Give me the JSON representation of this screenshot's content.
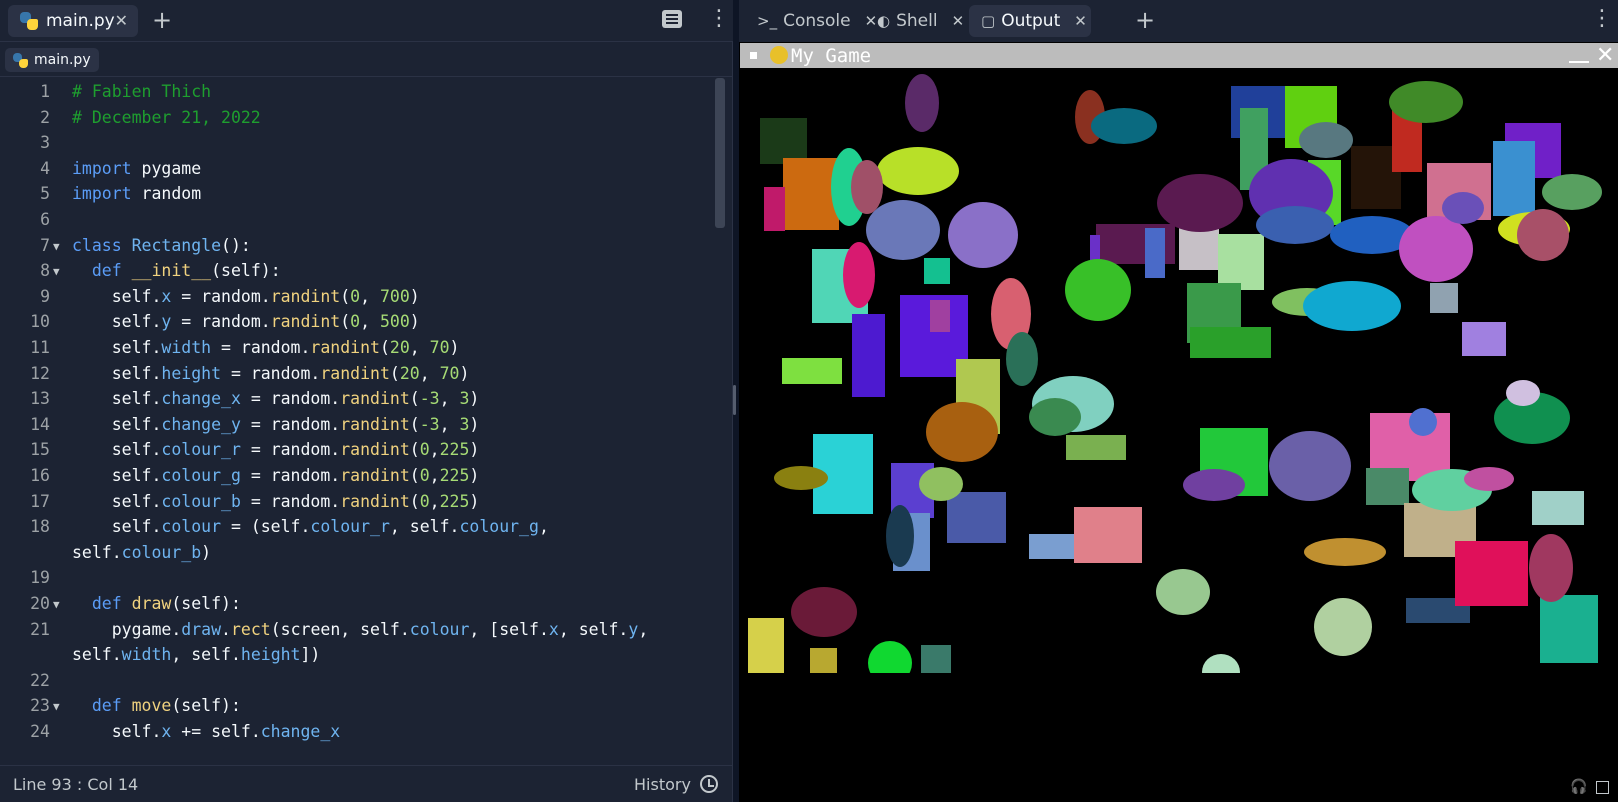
{
  "editor": {
    "tab_label": "main.py",
    "breadcrumb_label": "main.py",
    "status_position": "Line 93 : Col 14",
    "history_label": "History",
    "lines": [
      {
        "n": "1",
        "fold": false,
        "html": "<span class=\"cm\"># Fabien Thich</span>"
      },
      {
        "n": "2",
        "fold": false,
        "html": "<span class=\"cm\"># December 21, 2022</span>"
      },
      {
        "n": "3",
        "fold": false,
        "html": ""
      },
      {
        "n": "4",
        "fold": false,
        "html": "<span class=\"kw\">import</span> pygame"
      },
      {
        "n": "5",
        "fold": false,
        "html": "<span class=\"kw\">import</span> random"
      },
      {
        "n": "6",
        "fold": false,
        "html": ""
      },
      {
        "n": "7",
        "fold": true,
        "html": "<span class=\"kw\">class</span> <span class=\"at\">Rectangle</span>():"
      },
      {
        "n": "8",
        "fold": true,
        "html": "  <span class=\"kw\">def</span> <span class=\"fn\">__init__</span>(self):"
      },
      {
        "n": "9",
        "fold": false,
        "html": "    self.<span class=\"at\">x</span> = random.<span class=\"fn\">randint</span>(<span class=\"num\">0</span>, <span class=\"num\">700</span>)"
      },
      {
        "n": "10",
        "fold": false,
        "html": "    self.<span class=\"at\">y</span> = random.<span class=\"fn\">randint</span>(<span class=\"num\">0</span>, <span class=\"num\">500</span>)"
      },
      {
        "n": "11",
        "fold": false,
        "html": "    self.<span class=\"at\">width</span> = random.<span class=\"fn\">randint</span>(<span class=\"num\">20</span>, <span class=\"num\">70</span>)"
      },
      {
        "n": "12",
        "fold": false,
        "html": "    self.<span class=\"at\">height</span> = random.<span class=\"fn\">randint</span>(<span class=\"num\">20</span>, <span class=\"num\">70</span>)"
      },
      {
        "n": "13",
        "fold": false,
        "html": "    self.<span class=\"at\">change_x</span> = random.<span class=\"fn\">randint</span>(<span class=\"num\">-3</span>, <span class=\"num\">3</span>)"
      },
      {
        "n": "14",
        "fold": false,
        "html": "    self.<span class=\"at\">change_y</span> = random.<span class=\"fn\">randint</span>(<span class=\"num\">-3</span>, <span class=\"num\">3</span>)"
      },
      {
        "n": "15",
        "fold": false,
        "html": "    self.<span class=\"at\">colour_r</span> = random.<span class=\"fn\">randint</span>(<span class=\"num\">0</span>,<span class=\"num\">225</span>)"
      },
      {
        "n": "16",
        "fold": false,
        "html": "    self.<span class=\"at\">colour_g</span> = random.<span class=\"fn\">randint</span>(<span class=\"num\">0</span>,<span class=\"num\">225</span>)"
      },
      {
        "n": "17",
        "fold": false,
        "html": "    self.<span class=\"at\">colour_b</span> = random.<span class=\"fn\">randint</span>(<span class=\"num\">0</span>,<span class=\"num\">225</span>)"
      },
      {
        "n": "18",
        "fold": false,
        "html": "    self.<span class=\"at\">colour</span> = (self.<span class=\"at\">colour_r</span>, self.<span class=\"at\">colour_g</span>,"
      },
      {
        "n": "",
        "fold": false,
        "html": "self.<span class=\"at\">colour_b</span>)",
        "wrap": true
      },
      {
        "n": "19",
        "fold": false,
        "html": ""
      },
      {
        "n": "20",
        "fold": true,
        "html": "  <span class=\"kw\">def</span> <span class=\"fn\">draw</span>(self):"
      },
      {
        "n": "21",
        "fold": false,
        "html": "    pygame.<span class=\"at\">draw</span>.<span class=\"fn\">rect</span>(screen, self.<span class=\"at\">colour</span>, [self.<span class=\"at\">x</span>, self.<span class=\"at\">y</span>,"
      },
      {
        "n": "",
        "fold": false,
        "html": "self.<span class=\"at\">width</span>, self.<span class=\"at\">height</span>])",
        "wrap": true
      },
      {
        "n": "22",
        "fold": false,
        "html": ""
      },
      {
        "n": "23",
        "fold": true,
        "html": "  <span class=\"kw\">def</span> <span class=\"fn\">move</span>(self):"
      },
      {
        "n": "24",
        "fold": false,
        "html": "    self.<span class=\"at\">x</span> += self.<span class=\"at\">change_x</span>"
      }
    ]
  },
  "right_tabs": [
    {
      "label": "Console",
      "icon": "terminal-icon",
      "glyph": ">_",
      "active": false
    },
    {
      "label": "Shell",
      "icon": "shell-icon",
      "glyph": "◐",
      "active": false
    },
    {
      "label": "Output",
      "icon": "monitor-icon",
      "glyph": "▢",
      "active": true
    }
  ],
  "game": {
    "title": "My Game",
    "rects": [
      [
        "#1b3a18"
      ],
      [
        "#cc6a10"
      ],
      [
        "#c01a6a"
      ],
      [
        "#50d6b6"
      ],
      [
        "#4d1ad0"
      ],
      [
        "#5a1adb"
      ],
      [
        "#7ee040"
      ],
      [
        "#2ad2d6"
      ],
      [
        "#5b3fd0"
      ],
      [
        "#6a90cc"
      ],
      [
        "#d6d04a"
      ],
      [
        "#b8a830"
      ],
      [
        "#3a7a6a"
      ],
      [
        "#b0c850"
      ],
      [
        "#14c090"
      ],
      [
        "#4a5aa8"
      ],
      [
        "#7a9ed0"
      ],
      [
        "#e0808a"
      ],
      [
        "#7ab050"
      ],
      [
        "#5a1a50"
      ],
      [
        "#c6c0c6"
      ],
      [
        "#a8e0a0"
      ],
      [
        "#3a9a4a"
      ],
      [
        "#2aa02a"
      ],
      [
        "#22c83a"
      ],
      [
        "#e060a8"
      ],
      [
        "#4a8a68"
      ],
      [
        "#c0b08a"
      ],
      [
        "#2a4a70"
      ],
      [
        "#e0105a"
      ],
      [
        "#20409a"
      ],
      [
        "#40a060"
      ],
      [
        "#60d010"
      ],
      [
        "#58d828"
      ],
      [
        "#241408"
      ],
      [
        "#d07090"
      ],
      [
        "#7020c8"
      ],
      [
        "#3a90d0"
      ],
      [
        "#a080e0"
      ],
      [
        "#a0d0c8"
      ],
      [
        "#1ab090"
      ],
      [
        "#6a30c8"
      ],
      [
        "#c02a20"
      ],
      [
        "#4a6ac8"
      ],
      [
        "#90a2b0"
      ],
      [
        "#a040a0"
      ]
    ],
    "ellipses": [
      [
        "#5a2a68"
      ],
      [
        "#b8e028"
      ],
      [
        "#20d090"
      ],
      [
        "#a05068"
      ],
      [
        "#6a78b8"
      ],
      [
        "#8a70c8"
      ],
      [
        "#d81a70"
      ],
      [
        "#d86070"
      ],
      [
        "#2a7058"
      ],
      [
        "#80d0c0"
      ],
      [
        "#3a8a50"
      ],
      [
        "#a86010"
      ],
      [
        "#8a8010"
      ],
      [
        "#90c060"
      ],
      [
        "#1a3a50"
      ],
      [
        "#6a1a38"
      ],
      [
        "#10d830"
      ],
      [
        "#8a3020"
      ],
      [
        "#0a6a80"
      ],
      [
        "#587880"
      ],
      [
        "#408a28"
      ],
      [
        "#5a1a50"
      ],
      [
        "#6030b0"
      ],
      [
        "#3a60b0"
      ],
      [
        "#2060c0"
      ],
      [
        "#c050c0"
      ],
      [
        "#6a50b8"
      ],
      [
        "#d0e020"
      ],
      [
        "#a85068"
      ],
      [
        "#38c028"
      ],
      [
        "#80c060"
      ],
      [
        "#10a8d0"
      ],
      [
        "#6a60a8"
      ],
      [
        "#7040a0"
      ],
      [
        "#c09030"
      ],
      [
        "#98c890"
      ],
      [
        "#b0d0a0"
      ],
      [
        "#5070d0"
      ],
      [
        "#60d0a0"
      ],
      [
        "#c050a0"
      ],
      [
        "#109050"
      ],
      [
        "#a03860"
      ],
      [
        "#d0c0e0"
      ],
      [
        "#b0e0c0"
      ],
      [
        "#58a060"
      ],
      [
        "#888068"
      ]
    ]
  }
}
